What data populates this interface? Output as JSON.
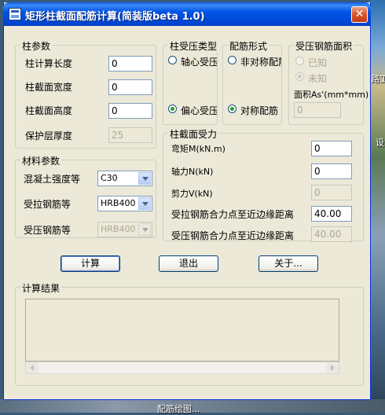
{
  "desktop": {
    "labels": [
      "路工",
      "设",
      "配筋绘图..."
    ]
  },
  "window": {
    "title": "矩形柱截面配筋计算(简装版beta 1.0)",
    "close_glyph": "✕"
  },
  "column_params": {
    "legend": "柱参数",
    "calc_length_label": "柱计算长度",
    "calc_length_value": "0",
    "width_label": "柱截面宽度",
    "width_value": "0",
    "height_label": "柱截面高度",
    "height_value": "0",
    "cover_label": "保护层厚度",
    "cover_value": "25"
  },
  "compression_type": {
    "legend": "柱受压类型",
    "option_axial": "轴心受压",
    "option_eccentric": "偏心受压"
  },
  "reinforcement_form": {
    "legend": "配筋形式",
    "option_asym": "非对称配筋",
    "option_sym": "对称配筋"
  },
  "compression_steel_area": {
    "legend": "受压钢筋面积",
    "option_known": "已知",
    "option_unknown": "未知",
    "area_label": "面积As'(mm*mm)",
    "area_value": "0"
  },
  "material_params": {
    "legend": "材料参数",
    "concrete_label": "混凝土强度等",
    "concrete_value": "C30",
    "tension_steel_label": "受拉钢筋等",
    "tension_steel_value": "HRB400",
    "compression_steel_label": "受压钢筋等",
    "compression_steel_value": "HRB400"
  },
  "section_forces": {
    "legend": "柱截面受力",
    "moment_label": "弯矩M(kN.m)",
    "moment_value": "0",
    "axial_label": "轴力N(kN)",
    "axial_value": "0",
    "shear_label": "剪力V(kN)",
    "shear_value": "0",
    "tension_dist_label": "受拉钢筋合力点至近边缘距离",
    "tension_dist_value": "40.00",
    "compression_dist_label": "受压钢筋合力点至近边缘距离",
    "compression_dist_value": "40.00"
  },
  "buttons": {
    "calculate": "计算",
    "exit": "退出",
    "about": "关于..."
  },
  "results": {
    "legend": "计算结果"
  }
}
